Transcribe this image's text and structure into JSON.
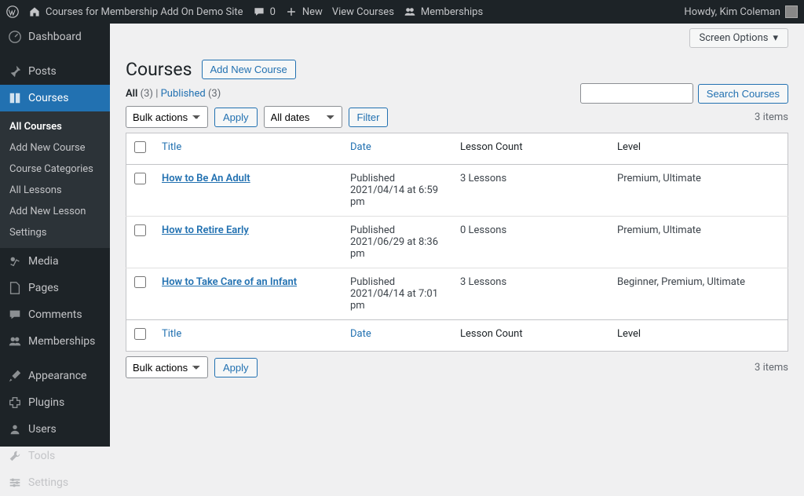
{
  "adminbar": {
    "site_name": "Courses for Membership Add On Demo Site",
    "comments_count": "0",
    "new": "New",
    "view_courses": "View Courses",
    "memberships": "Memberships",
    "howdy": "Howdy, Kim Coleman"
  },
  "sidebar": {
    "dashboard": "Dashboard",
    "posts": "Posts",
    "courses": "Courses",
    "media": "Media",
    "pages": "Pages",
    "comments": "Comments",
    "memberships": "Memberships",
    "appearance": "Appearance",
    "plugins": "Plugins",
    "users": "Users",
    "tools": "Tools",
    "settings": "Settings",
    "sub": {
      "all_courses": "All Courses",
      "add_new_course": "Add New Course",
      "course_categories": "Course Categories",
      "all_lessons": "All Lessons",
      "add_new_lesson": "Add New Lesson",
      "settings": "Settings"
    }
  },
  "screen_options": "Screen Options",
  "page": {
    "title": "Courses",
    "add_new": "Add New Course"
  },
  "filters": {
    "all_label": "All",
    "all_count": "(3)",
    "published_label": "Published",
    "published_count": "(3)",
    "separator": "  |  "
  },
  "search": {
    "button": "Search Courses"
  },
  "bulk": {
    "placeholder": "Bulk actions",
    "apply": "Apply",
    "all_dates": "All dates",
    "filter": "Filter"
  },
  "items_count": "3 items",
  "columns": {
    "title": "Title",
    "date": "Date",
    "lesson_count": "Lesson Count",
    "level": "Level"
  },
  "rows": [
    {
      "title": "How to Be An Adult",
      "date_status": "Published",
      "date": "2021/04/14 at 6:59 pm",
      "lessons": "3 Lessons",
      "level": "Premium, Ultimate"
    },
    {
      "title": "How to Retire Early",
      "date_status": "Published",
      "date": "2021/06/29 at 8:36 pm",
      "lessons": "0 Lessons",
      "level": "Premium, Ultimate"
    },
    {
      "title": "How to Take Care of an Infant",
      "date_status": "Published",
      "date": "2021/04/14 at 7:01 pm",
      "lessons": "3 Lessons",
      "level": "Beginner, Premium, Ultimate"
    }
  ]
}
